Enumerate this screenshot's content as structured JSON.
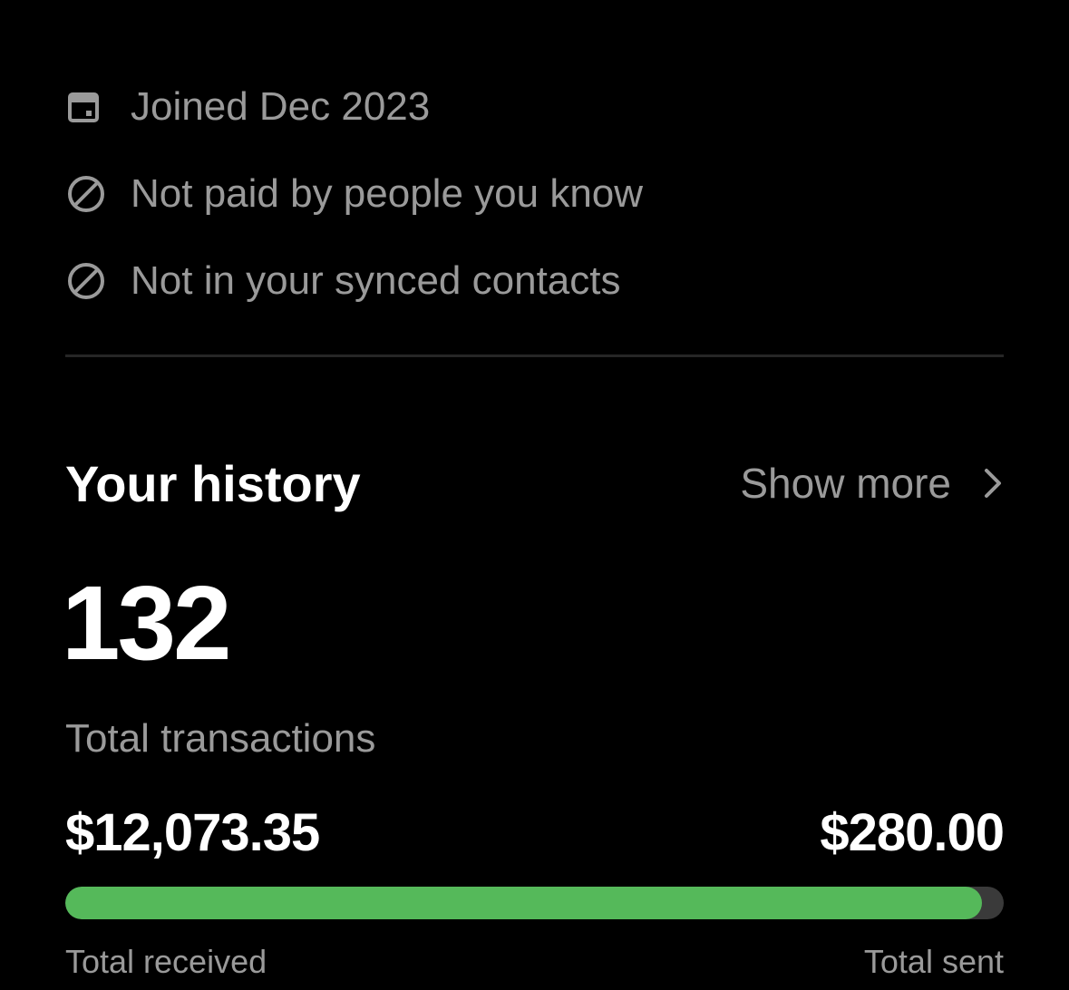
{
  "profile_info": {
    "items": [
      {
        "icon": "calendar-icon",
        "text": "Joined Dec 2023"
      },
      {
        "icon": "blocked-icon",
        "text": "Not paid by people you know"
      },
      {
        "icon": "blocked-icon",
        "text": "Not in your synced contacts"
      }
    ]
  },
  "history": {
    "title": "Your history",
    "show_more_label": "Show more",
    "total_transactions": "132",
    "total_transactions_label": "Total transactions",
    "total_received": "$12,073.35",
    "total_sent": "$280.00",
    "total_received_label": "Total received",
    "total_sent_label": "Total sent",
    "received_share": 0.977
  },
  "colors": {
    "background": "#000000",
    "primary_text": "#ffffff",
    "secondary_text": "#9a9a9a",
    "received_bar": "#55b95a",
    "sent_bar": "#3a3a3a",
    "divider": "#262626"
  }
}
